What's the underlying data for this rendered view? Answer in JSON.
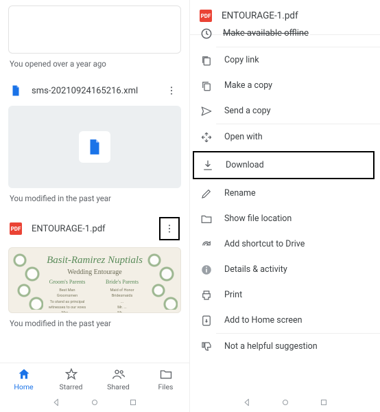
{
  "left": {
    "opened_meta": "You opened over a year ago",
    "file1": {
      "name": "sms-20210924165216.xml",
      "meta": "You modified in the past year"
    },
    "file2": {
      "name": "ENTOURAGE-1.pdf",
      "meta": "You modified in the past year",
      "thumb": {
        "title": "Basit-Ramirez Nuptials",
        "subtitle": "Wedding Entourage",
        "col1_h": "Groom's Parents",
        "col2_h": "Bride's Parents"
      }
    },
    "nav": {
      "home": "Home",
      "starred": "Starred",
      "shared": "Shared",
      "files": "Files"
    }
  },
  "right": {
    "filename": "ENTOURAGE-1.pdf",
    "pdf_label": "PDF",
    "truncated": "Make available offline",
    "items": {
      "copy_link": "Copy link",
      "make_copy": "Make a copy",
      "send_copy": "Send a copy",
      "open_with": "Open with",
      "download": "Download",
      "rename": "Rename",
      "show_loc": "Show file location",
      "add_shortcut": "Add shortcut to Drive",
      "details": "Details & activity",
      "print": "Print",
      "add_home": "Add to Home screen",
      "not_helpful": "Not a helpful suggestion"
    }
  }
}
